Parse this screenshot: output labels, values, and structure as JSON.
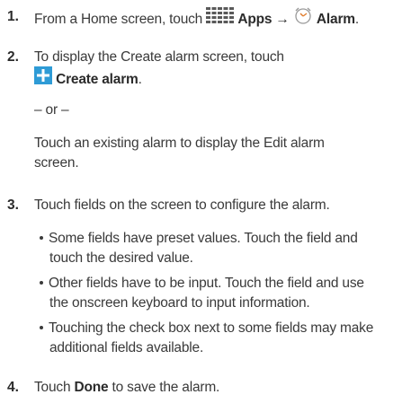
{
  "steps": [
    {
      "number": "1.",
      "pre": "From a Home screen, touch",
      "apps_label": "Apps",
      "arrow": "→",
      "alarm_label": "Alarm",
      "end": "."
    },
    {
      "number": "2.",
      "line1": "To display the Create alarm screen, touch",
      "create_label": "Create alarm",
      "end": ".",
      "or": "– or –",
      "alt_line1": "Touch an existing alarm to display the Edit alarm",
      "alt_line2": "screen."
    },
    {
      "number": "3.",
      "line1": "Touch fields on the screen to configure the alarm.",
      "bullets": [
        {
          "line1": "Some fields have preset values. Touch the field and",
          "line2": "touch the desired value."
        },
        {
          "line1": "Other fields have to be input. Touch the field and use",
          "line2": "the onscreen keyboard to input information."
        },
        {
          "line1": "Touching the check box next to some fields may make",
          "line2": "additional fields available."
        }
      ]
    },
    {
      "number": "4.",
      "pre": "Touch",
      "done_label": "Done",
      "post": "to save the alarm."
    }
  ],
  "icons": {
    "apps_icon": "apps-grid-icon",
    "alarm_icon": "alarm-clock-icon",
    "create_icon": "plus-icon",
    "accent": "#2e9bd6"
  }
}
